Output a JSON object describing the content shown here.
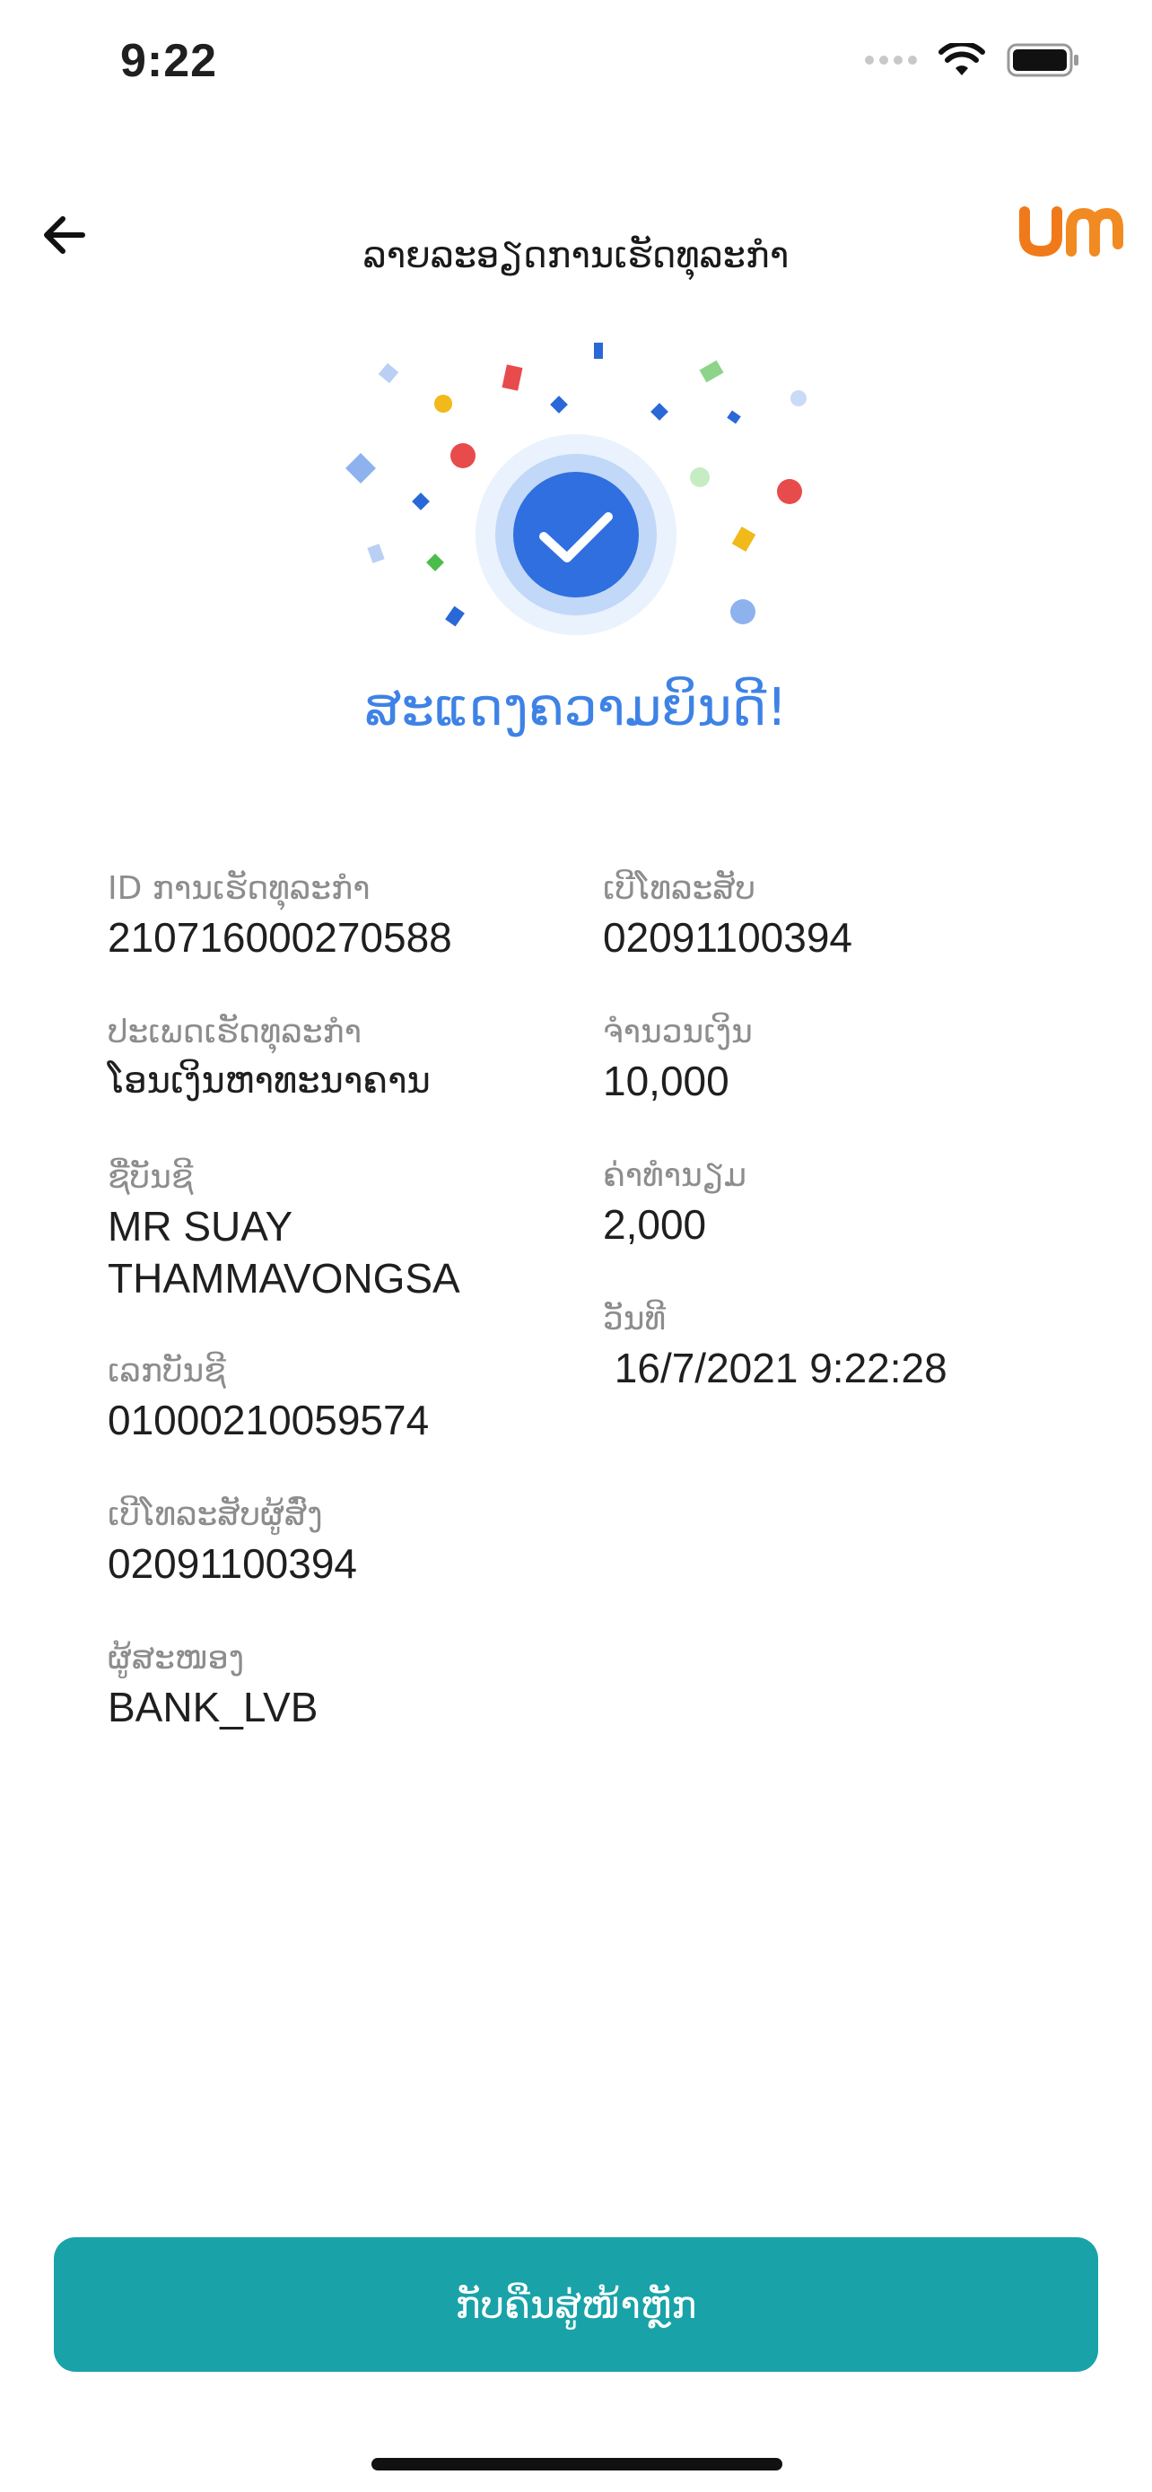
{
  "status_bar": {
    "time": "9:22"
  },
  "header": {
    "title": "ລາຍລະອຽດການເຮັດທຸລະກຳ"
  },
  "hero": {
    "message": "ສະແດງຄວາມຍິນດີ!"
  },
  "details": {
    "left": [
      {
        "label": "ID ການເຮັດທຸລະກຳ",
        "value": "210716000270588"
      },
      {
        "label": "ປະເພດເຮັດທຸລະກຳ",
        "value": "ໂອນເງິນຫາທະນາຄານ"
      },
      {
        "label": "ຊື່ບັນຊີ",
        "value": "MR SUAY THAMMAVONGSA"
      },
      {
        "label": "ເລກບັນຊີ",
        "value": "01000210059574"
      },
      {
        "label": "ເບີໂທລະສັບຜູ້ສົ່ງ",
        "value": "02091100394"
      },
      {
        "label": "ຜູ້ສະໜອງ",
        "value": "BANK_LVB"
      }
    ],
    "right": [
      {
        "label": "ເບີໂທລະສັບ",
        "value": "02091100394"
      },
      {
        "label": "ຈຳນວນເງິນ",
        "value": "10,000"
      },
      {
        "label": "ຄ່າທຳນຽມ",
        "value": "2,000"
      },
      {
        "label": "ວັນທີ",
        "value": " 16/7/2021 9:22:28"
      }
    ]
  },
  "footer": {
    "home_button": "ກັບຄືນສູ່ໜ້າຫຼັກ"
  },
  "colors": {
    "accent": "#3e82e6",
    "button": "#19a3a9",
    "brand_orange": "#f07a1a"
  }
}
